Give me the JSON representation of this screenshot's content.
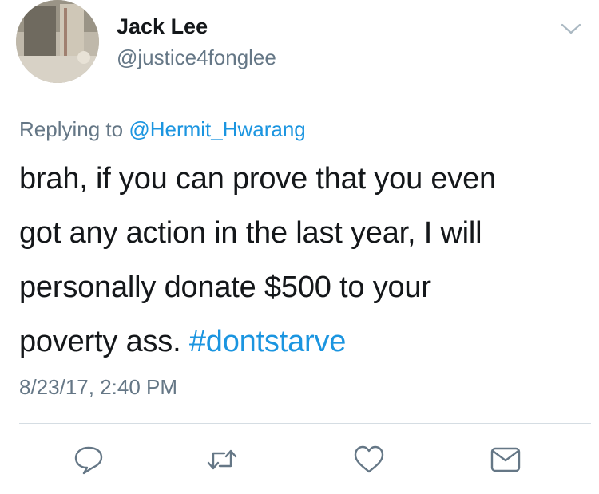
{
  "author": {
    "display_name": "Jack Lee",
    "handle": "@justice4fonglee"
  },
  "reply": {
    "prefix": "Replying to ",
    "mention": "@Hermit_Hwarang"
  },
  "tweet": {
    "line1": "brah, if you can prove that you even",
    "line2": "got any action in the last year, I will",
    "line3": "personally donate $500 to your",
    "line4_text": "poverty ass. ",
    "hashtag": "#dontstarve",
    "timestamp": "8/23/17, 2:40 PM"
  },
  "actions": {
    "reply_icon": "reply-icon",
    "retweet_icon": "retweet-icon",
    "like_icon": "heart-icon",
    "dm_icon": "envelope-icon"
  },
  "colors": {
    "link": "#1b95e0",
    "secondary_text": "#657786",
    "primary_text": "#14171a",
    "icon": "#657786",
    "divider": "#d5dde3"
  }
}
